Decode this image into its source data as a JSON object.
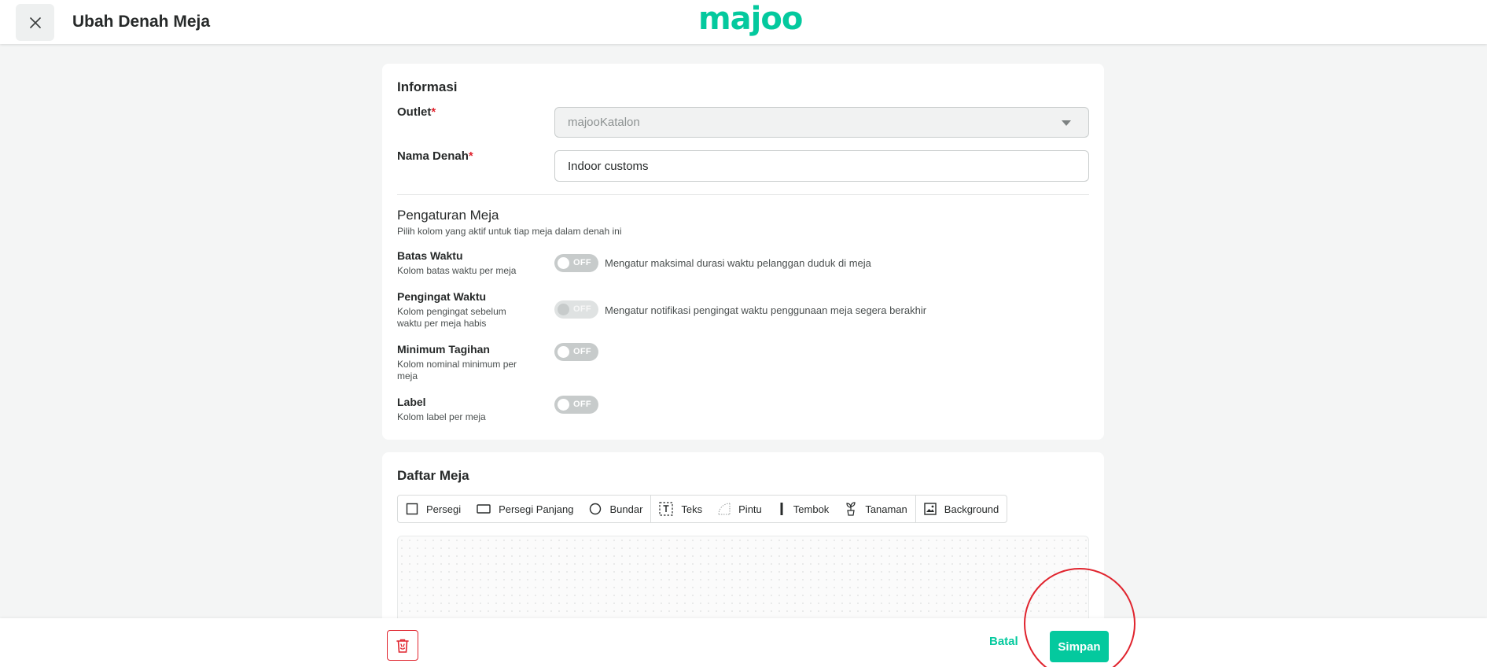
{
  "header": {
    "title": "Ubah Denah Meja",
    "logo_text": "majoo",
    "brand_color": "#04c99e",
    "close_icon": "close-icon"
  },
  "info": {
    "section_title": "Informasi",
    "outlet_label": "Outlet",
    "outlet_value": "majooKatalon",
    "name_label": "Nama Denah",
    "name_value": "Indoor customs",
    "required_mark": "*"
  },
  "settings": {
    "title": "Pengaturan Meja",
    "subtitle": "Pilih kolom yang aktif untuk tiap meja dalam denah ini",
    "rows": [
      {
        "label": "Batas Waktu",
        "desc": "Kolom batas waktu per meja",
        "toggle": "OFF",
        "toggle_desc": "Mengatur maksimal durasi waktu pelanggan duduk di meja",
        "disabled": false
      },
      {
        "label": "Pengingat Waktu",
        "desc": "Kolom pengingat sebelum waktu per meja habis",
        "toggle": "OFF",
        "toggle_desc": "Mengatur notifikasi pengingat waktu penggunaan meja segera berakhir",
        "disabled": true
      },
      {
        "label": "Minimum Tagihan",
        "desc": "Kolom nominal minimum per meja",
        "toggle": "OFF",
        "toggle_desc": "",
        "disabled": false
      },
      {
        "label": "Label",
        "desc": "Kolom label per meja",
        "toggle": "OFF",
        "toggle_desc": "",
        "disabled": false
      }
    ]
  },
  "table_list": {
    "title": "Daftar Meja",
    "tools": [
      {
        "label": "Persegi",
        "icon": "square-icon"
      },
      {
        "label": "Persegi Panjang",
        "icon": "rectangle-icon"
      },
      {
        "label": "Bundar",
        "icon": "circle-icon"
      },
      {
        "label": "Teks",
        "icon": "text-icon"
      },
      {
        "label": "Pintu",
        "icon": "door-icon"
      },
      {
        "label": "Tembok",
        "icon": "wall-icon"
      },
      {
        "label": "Tanaman",
        "icon": "plant-icon"
      },
      {
        "label": "Background",
        "icon": "image-icon"
      }
    ]
  },
  "footer": {
    "cancel_label": "Batal",
    "save_label": "Simpan",
    "delete_icon": "trash-icon",
    "danger_color": "#e0242e"
  }
}
